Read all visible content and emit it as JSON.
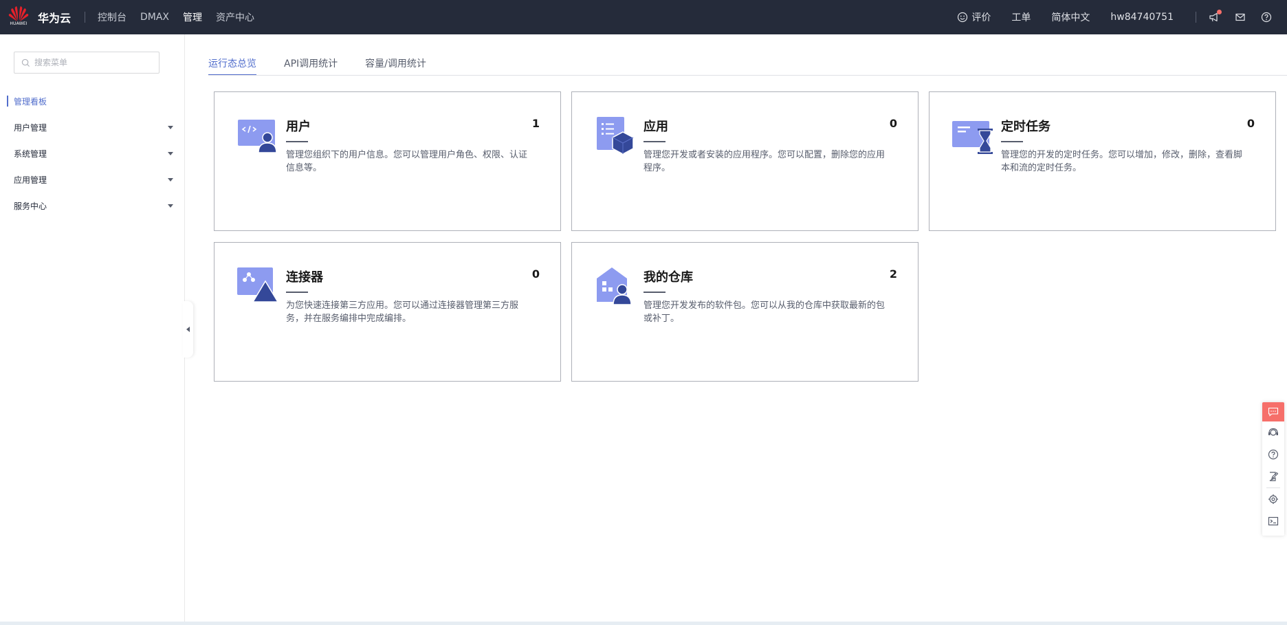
{
  "topbar": {
    "logo_text": "HUAWEI",
    "brand": "华为云",
    "nav": [
      "控制台",
      "DMAX",
      "管理",
      "资产中心"
    ],
    "active_nav": "管理",
    "feedback": "评价",
    "ticket": "工单",
    "language": "简体中文",
    "username": "hw84740751"
  },
  "sidebar": {
    "search_placeholder": "搜索菜单",
    "items": [
      {
        "label": "管理看板"
      },
      {
        "label": "用户管理"
      },
      {
        "label": "系统管理"
      },
      {
        "label": "应用管理"
      },
      {
        "label": "服务中心"
      }
    ]
  },
  "tabs": [
    "运行态总览",
    "API调用统计",
    "容量/调用统计"
  ],
  "cards": [
    {
      "title": "用户",
      "count": "1",
      "desc": "管理您组织下的用户信息。您可以管理用户角色、权限、认证信息等。",
      "icon": "user-code-icon"
    },
    {
      "title": "应用",
      "count": "0",
      "desc": "管理您开发或者安装的应用程序。您可以配置，删除您的应用程序。",
      "icon": "app-list-icon"
    },
    {
      "title": "定时任务",
      "count": "0",
      "desc": "管理您的开发的定时任务。您可以增加，修改，删除，查看脚本和流的定时任务。",
      "icon": "hourglass-icon"
    },
    {
      "title": "连接器",
      "count": "0",
      "desc": "为您快速连接第三方应用。您可以通过连接器管理第三方服务，并在服务编排中完成编排。",
      "icon": "connector-icon"
    },
    {
      "title": "我的仓库",
      "count": "2",
      "desc": "管理您开发发布的软件包。您可以从我的仓库中获取最新的包或补丁。",
      "icon": "warehouse-icon"
    }
  ],
  "colors": {
    "topbar_bg": "#252b3a",
    "accent": "#526ecc",
    "icon_light": "#8d9bf0",
    "icon_dark": "#344899",
    "notice_red": "#f66f6a"
  }
}
